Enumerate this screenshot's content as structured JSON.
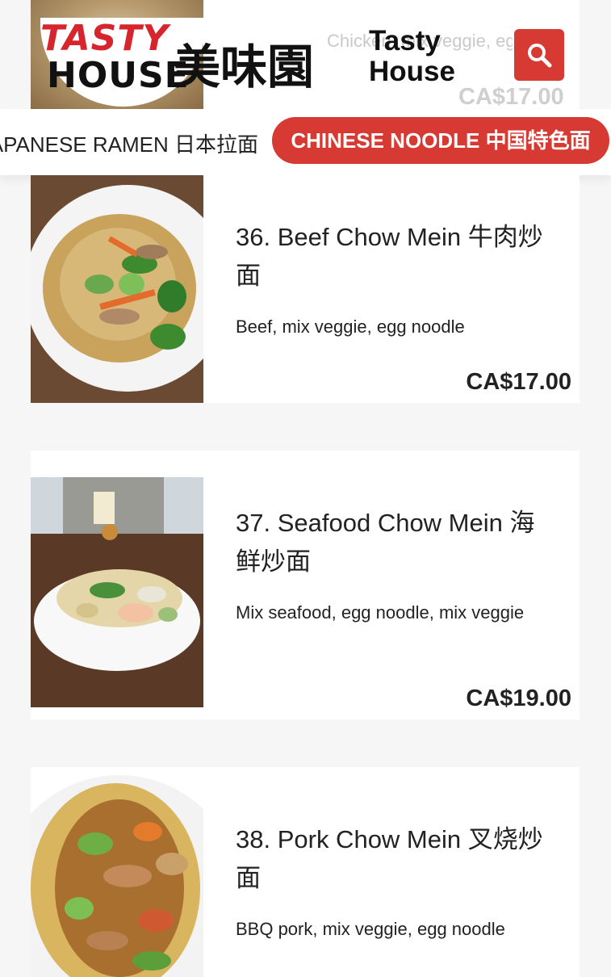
{
  "peek_item": {
    "description": "Chicken, mix veggie, egg noodle",
    "price": "CA$17.00"
  },
  "header": {
    "logo_line1": "TASTY",
    "logo_line2": "HOUSE",
    "logo_chinese": "美味園",
    "brand_name": "Tasty House",
    "search_icon": "search-icon"
  },
  "tabs": [
    {
      "label": "JAPANESE RAMEN 日本拉面",
      "active": false
    },
    {
      "label": "CHINESE NOODLE 中国特色面",
      "active": true
    }
  ],
  "items": [
    {
      "title": "36. Beef Chow Mein 牛肉炒面",
      "description": "Beef, mix veggie, egg noodle",
      "price": "CA$17.00"
    },
    {
      "title": "37. Seafood Chow Mein 海鲜炒面",
      "description": "Mix seafood, egg noodle, mix veggie",
      "price": "CA$19.00"
    },
    {
      "title": "38. Pork Chow Mein 叉烧炒面",
      "description": "BBQ pork, mix veggie, egg noodle",
      "price": ""
    }
  ],
  "colors": {
    "accent": "#d63a32",
    "logo_red": "#d6252c",
    "background": "#f6f6f6"
  }
}
